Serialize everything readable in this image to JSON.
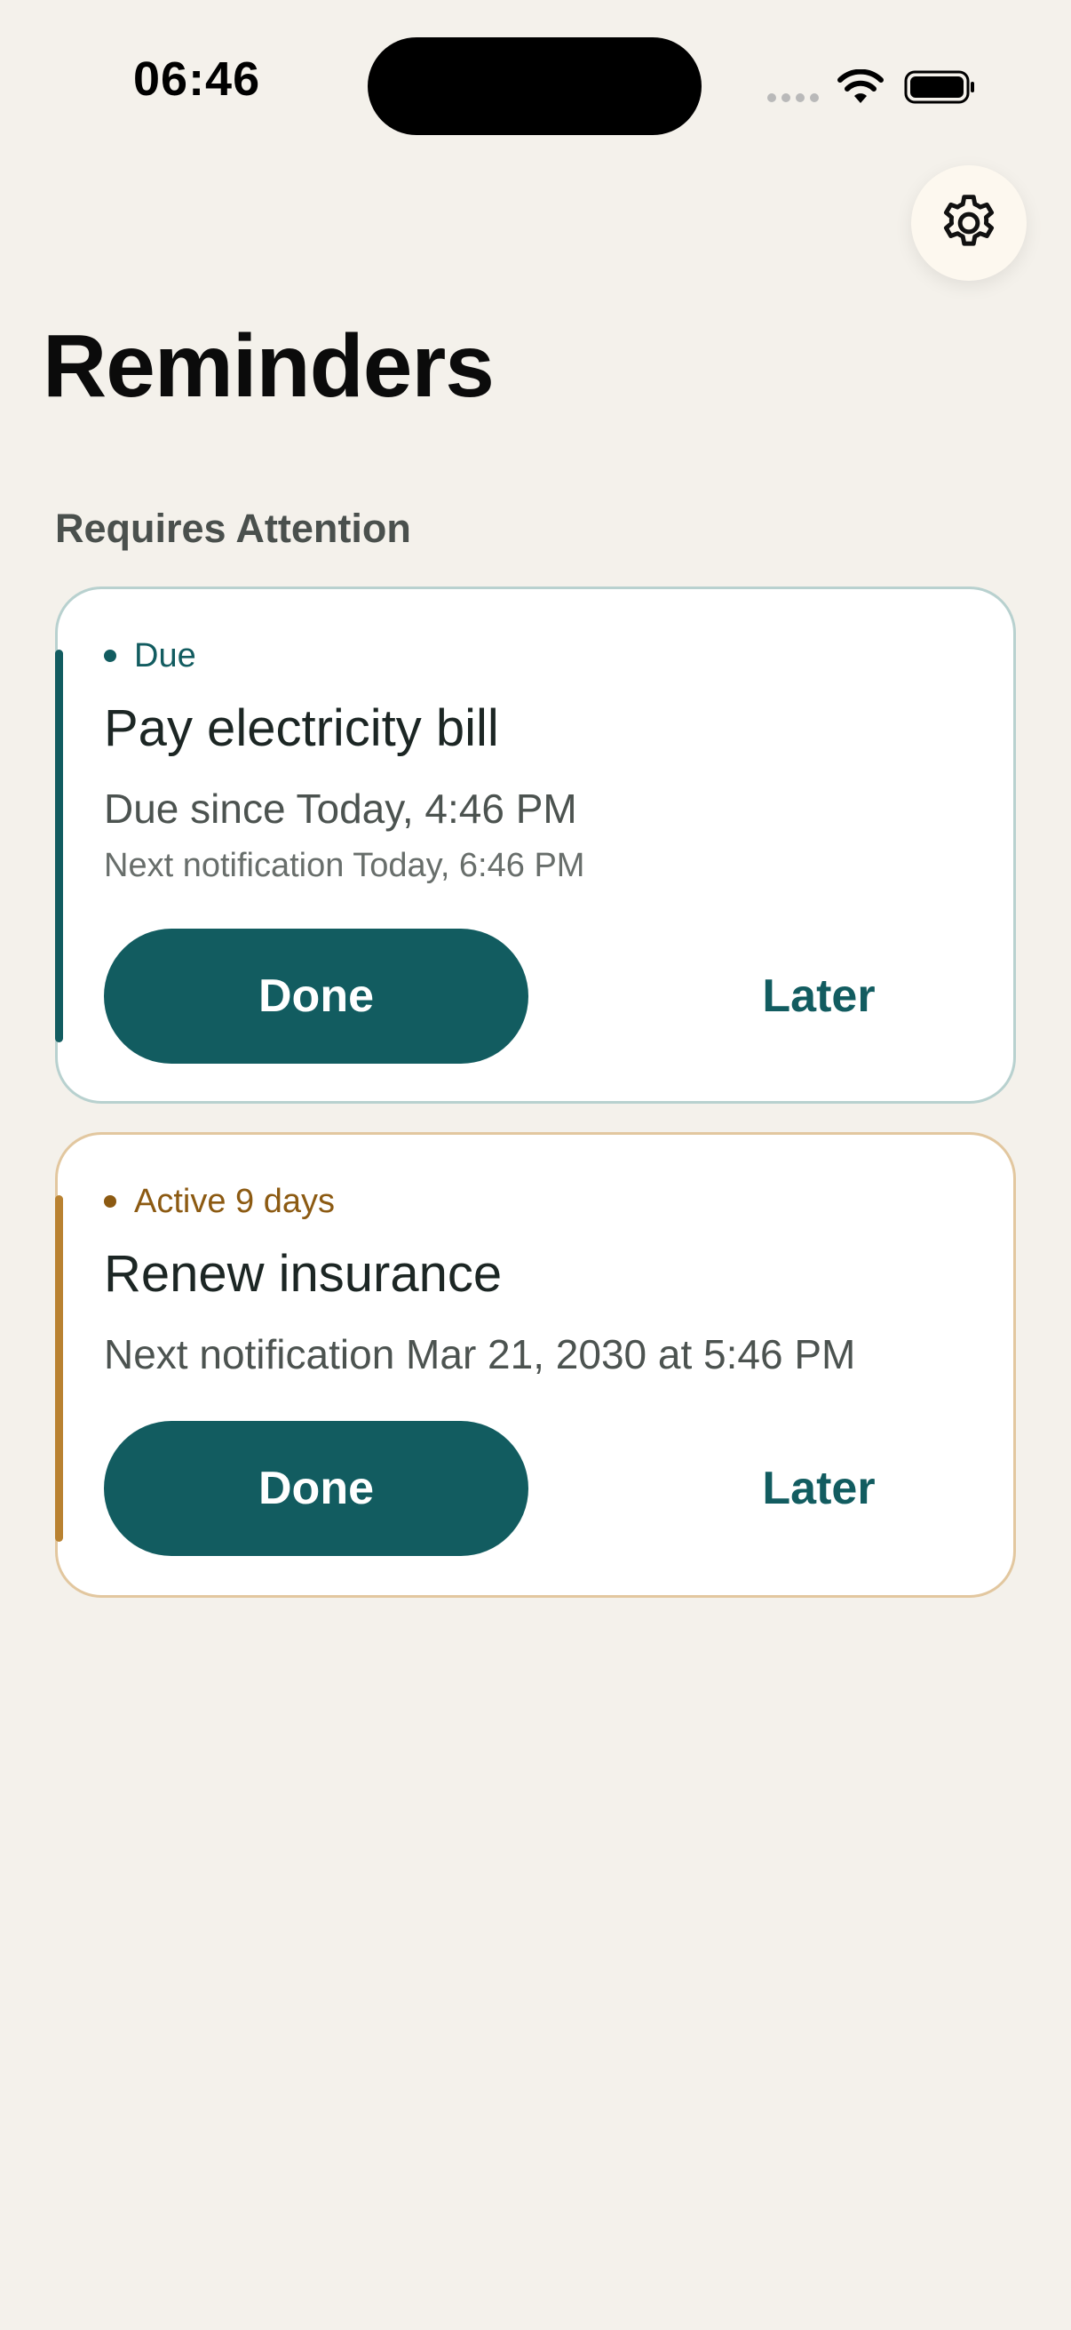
{
  "status_bar": {
    "time": "06:46",
    "icons": [
      "signal-dots-icon",
      "wifi-icon",
      "battery-icon"
    ]
  },
  "header": {
    "settings_icon": "gear-icon",
    "title": "Reminders"
  },
  "section": {
    "title": "Requires Attention"
  },
  "reminders": [
    {
      "status": "Due",
      "title": "Pay electricity bill",
      "detail": "Due since Today, 4:46 PM",
      "sub_detail": "Next notification Today, 6:46 PM",
      "done_label": "Done",
      "later_label": "Later",
      "accent_color": "#125c60"
    },
    {
      "status": "Active 9 days",
      "title": "Renew insurance",
      "detail": "Next notification Mar 21, 2030 at 5:46 PM",
      "done_label": "Done",
      "later_label": "Later",
      "accent_color": "#b98231"
    }
  ],
  "colors": {
    "background": "#f4f1eb",
    "primary": "#125c60",
    "warning": "#8c5a12"
  }
}
